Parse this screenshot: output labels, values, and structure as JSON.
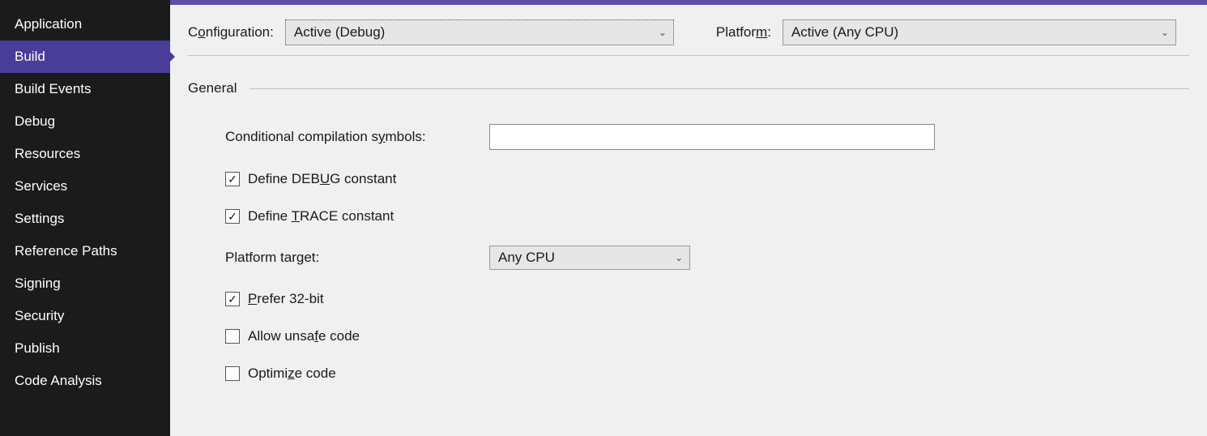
{
  "sidebar": {
    "items": [
      {
        "label": "Application",
        "active": false
      },
      {
        "label": "Build",
        "active": true
      },
      {
        "label": "Build Events",
        "active": false
      },
      {
        "label": "Debug",
        "active": false
      },
      {
        "label": "Resources",
        "active": false
      },
      {
        "label": "Services",
        "active": false
      },
      {
        "label": "Settings",
        "active": false
      },
      {
        "label": "Reference Paths",
        "active": false
      },
      {
        "label": "Signing",
        "active": false
      },
      {
        "label": "Security",
        "active": false
      },
      {
        "label": "Publish",
        "active": false
      },
      {
        "label": "Code Analysis",
        "active": false
      }
    ]
  },
  "topbar": {
    "configuration_label_pre": "C",
    "configuration_label_u": "o",
    "configuration_label_post": "nfiguration:",
    "configuration_value": "Active (Debug)",
    "platform_label_pre": "Platfor",
    "platform_label_u": "m",
    "platform_label_post": ":",
    "platform_value": "Active (Any CPU)"
  },
  "section": {
    "title": "General"
  },
  "form": {
    "symbols_label_pre": "Conditional compilation s",
    "symbols_label_u": "y",
    "symbols_label_post": "mbols:",
    "symbols_value": "",
    "debug_pre": "Define DEB",
    "debug_u": "U",
    "debug_post": "G constant",
    "debug_checked": true,
    "trace_pre": "Define ",
    "trace_u": "T",
    "trace_post": "RACE constant",
    "trace_checked": true,
    "platform_target_label_pre": "Platform tar",
    "platform_target_label_u": "g",
    "platform_target_label_post": "et:",
    "platform_target_value": "Any CPU",
    "prefer32_pre": "",
    "prefer32_u": "P",
    "prefer32_post": "refer 32-bit",
    "prefer32_checked": true,
    "unsafe_pre": "Allow unsa",
    "unsafe_u": "f",
    "unsafe_post": "e code",
    "unsafe_checked": false,
    "optimize_pre": "Optimi",
    "optimize_u": "z",
    "optimize_post": "e code",
    "optimize_checked": false
  }
}
